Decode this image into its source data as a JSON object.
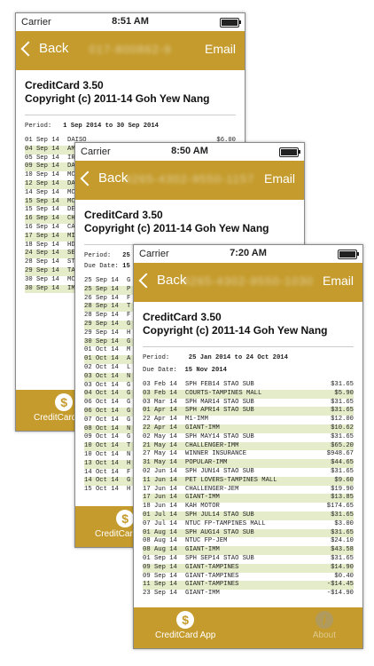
{
  "app_title": "CreditCard 3.50",
  "copyright": "Copyright (c) 2011-14 Goh Yew Nang",
  "nav": {
    "back_label": "Back",
    "email_label": "Email"
  },
  "tabbar": {
    "app_label": "CreditCard App",
    "info_label": "About"
  },
  "icons": {
    "back": "chevron-left-icon",
    "app": "dollar-icon",
    "info": "info-icon"
  },
  "colors": {
    "accent": "#c49b2c",
    "alt_row": "#e5ecc9"
  },
  "screens": [
    {
      "carrier": "Carrier",
      "time": "8:51 AM",
      "masked_title": "017-800862-9",
      "period_label": "Period:",
      "period_value": "1 Sep 2014 to 30 Sep 2014",
      "due_label": "",
      "due_value": "",
      "rows": [
        {
          "d": "01 Sep 14",
          "desc": "DAISO",
          "amt": "$6.00"
        },
        {
          "d": "04 Sep 14",
          "desc": "AM",
          "amt": ""
        },
        {
          "d": "05 Sep 14",
          "desc": "IR",
          "amt": ""
        },
        {
          "d": "09 Sep 14",
          "desc": "DA",
          "amt": ""
        },
        {
          "d": "10 Sep 14",
          "desc": "MC",
          "amt": ""
        },
        {
          "d": "12 Sep 14",
          "desc": "DA",
          "amt": ""
        },
        {
          "d": "14 Sep 14",
          "desc": "MC",
          "amt": ""
        },
        {
          "d": "15 Sep 14",
          "desc": "MC",
          "amt": ""
        },
        {
          "d": "15 Sep 14",
          "desc": "DE",
          "amt": ""
        },
        {
          "d": "16 Sep 14",
          "desc": "CH",
          "amt": ""
        },
        {
          "d": "16 Sep 14",
          "desc": "CA",
          "amt": ""
        },
        {
          "d": "17 Sep 14",
          "desc": "MI",
          "amt": ""
        },
        {
          "d": "18 Sep 14",
          "desc": "HD",
          "amt": ""
        },
        {
          "d": "24 Sep 14",
          "desc": "SE",
          "amt": ""
        },
        {
          "d": "28 Sep 14",
          "desc": "ST",
          "amt": ""
        },
        {
          "d": "29 Sep 14",
          "desc": "TA",
          "amt": ""
        },
        {
          "d": "30 Sep 14",
          "desc": "MC",
          "amt": ""
        },
        {
          "d": "30 Sep 14",
          "desc": "IM",
          "amt": ""
        }
      ]
    },
    {
      "carrier": "Carrier",
      "time": "8:50 AM",
      "masked_title": "4265-4302-9550-1157",
      "period_label": "Period:",
      "period_value": "25",
      "due_label": "Due Date:",
      "due_value": "15",
      "rows": [
        {
          "d": "25 Sep 14",
          "desc": "G",
          "amt": ""
        },
        {
          "d": "25 Sep 14",
          "desc": "P",
          "amt": ""
        },
        {
          "d": "26 Sep 14",
          "desc": "F",
          "amt": ""
        },
        {
          "d": "28 Sep 14",
          "desc": "T",
          "amt": ""
        },
        {
          "d": "28 Sep 14",
          "desc": "F",
          "amt": ""
        },
        {
          "d": "29 Sep 14",
          "desc": "G",
          "amt": ""
        },
        {
          "d": "29 Sep 14",
          "desc": "H",
          "amt": ""
        },
        {
          "d": "30 Sep 14",
          "desc": "G",
          "amt": ""
        },
        {
          "d": "01 Oct 14",
          "desc": "M",
          "amt": ""
        },
        {
          "d": "01 Oct 14",
          "desc": "A",
          "amt": ""
        },
        {
          "d": "02 Oct 14",
          "desc": "L",
          "amt": ""
        },
        {
          "d": "03 Oct 14",
          "desc": "N",
          "amt": ""
        },
        {
          "d": "03 Oct 14",
          "desc": "G",
          "amt": ""
        },
        {
          "d": "04 Oct 14",
          "desc": "G",
          "amt": ""
        },
        {
          "d": "06 Oct 14",
          "desc": "G",
          "amt": ""
        },
        {
          "d": "06 Oct 14",
          "desc": "G",
          "amt": ""
        },
        {
          "d": "07 Oct 14",
          "desc": "G",
          "amt": ""
        },
        {
          "d": "08 Oct 14",
          "desc": "N",
          "amt": ""
        },
        {
          "d": "09 Oct 14",
          "desc": "G",
          "amt": ""
        },
        {
          "d": "10 Oct 14",
          "desc": "T",
          "amt": ""
        },
        {
          "d": "10 Oct 14",
          "desc": "N",
          "amt": ""
        },
        {
          "d": "13 Oct 14",
          "desc": "H",
          "amt": ""
        },
        {
          "d": "14 Oct 14",
          "desc": "F",
          "amt": ""
        },
        {
          "d": "14 Oct 14",
          "desc": "G",
          "amt": ""
        },
        {
          "d": "15 Oct 14",
          "desc": "H",
          "amt": ""
        }
      ]
    },
    {
      "carrier": "Carrier",
      "time": "7:20 AM",
      "masked_title": "4265-4302-9550-1030",
      "period_label": "Period:",
      "period_value": "25 Jan 2014 to 24 Oct 2014",
      "due_label": "Due Date:",
      "due_value": "15 Nov 2014",
      "rows": [
        {
          "d": "03 Feb 14",
          "desc": "SPH FEB14 STAO SUB",
          "amt": "$31.65"
        },
        {
          "d": "03 Feb 14",
          "desc": "COURTS-TAMPINES MALL",
          "amt": "$5.90"
        },
        {
          "d": "03 Mar 14",
          "desc": "SPH MAR14 STAO SUB",
          "amt": "$31.65"
        },
        {
          "d": "01 Apr 14",
          "desc": "SPH APR14 STAO SUB",
          "amt": "$31.65"
        },
        {
          "d": "22 Apr 14",
          "desc": "M1-IMM",
          "amt": "$12.00"
        },
        {
          "d": "22 Apr 14",
          "desc": "GIANT-IMM",
          "amt": "$10.62"
        },
        {
          "d": "02 May 14",
          "desc": "SPH MAY14 STAO SUB",
          "amt": "$31.65"
        },
        {
          "d": "21 May 14",
          "desc": "CHALLENGER-IMM",
          "amt": "$65.20"
        },
        {
          "d": "27 May 14",
          "desc": "WINNER INSURANCE",
          "amt": "$948.67"
        },
        {
          "d": "31 May 14",
          "desc": "POPULAR-IMM",
          "amt": "$44.65"
        },
        {
          "d": "02 Jun 14",
          "desc": "SPH JUN14 STAO SUB",
          "amt": "$31.65"
        },
        {
          "d": "11 Jun 14",
          "desc": "PET LOVERS-TAMPINES MALL",
          "amt": "$9.60"
        },
        {
          "d": "17 Jun 14",
          "desc": "CHALLENGER-JEM",
          "amt": "$19.90"
        },
        {
          "d": "17 Jun 14",
          "desc": "GIANT-IMM",
          "amt": "$13.85"
        },
        {
          "d": "18 Jun 14",
          "desc": "KAH MOTOR",
          "amt": "$174.65"
        },
        {
          "d": "01 Jul 14",
          "desc": "SPH JUL14 STAO SUB",
          "amt": "$31.65"
        },
        {
          "d": "07 Jul 14",
          "desc": "NTUC FP-TAMPINES MALL",
          "amt": "$3.00"
        },
        {
          "d": "01 Aug 14",
          "desc": "SPH AUG14 STAO SUB",
          "amt": "$31.65"
        },
        {
          "d": "08 Aug 14",
          "desc": "NTUC FP-JEM",
          "amt": "$24.10"
        },
        {
          "d": "08 Aug 14",
          "desc": "GIANT-IMM",
          "amt": "$43.58"
        },
        {
          "d": "01 Sep 14",
          "desc": "SPH SEP14 STAO SUB",
          "amt": "$31.65"
        },
        {
          "d": "09 Sep 14",
          "desc": "GIANT-TAMPINES",
          "amt": "$14.90"
        },
        {
          "d": "09 Sep 14",
          "desc": "GIANT-TAMPINES",
          "amt": "$0.40"
        },
        {
          "d": "11 Sep 14",
          "desc": "GIANT-TAMPINES",
          "amt": "-$14.45"
        },
        {
          "d": "23 Sep 14",
          "desc": "GIANT-IMM",
          "amt": "-$14.90"
        }
      ]
    }
  ]
}
